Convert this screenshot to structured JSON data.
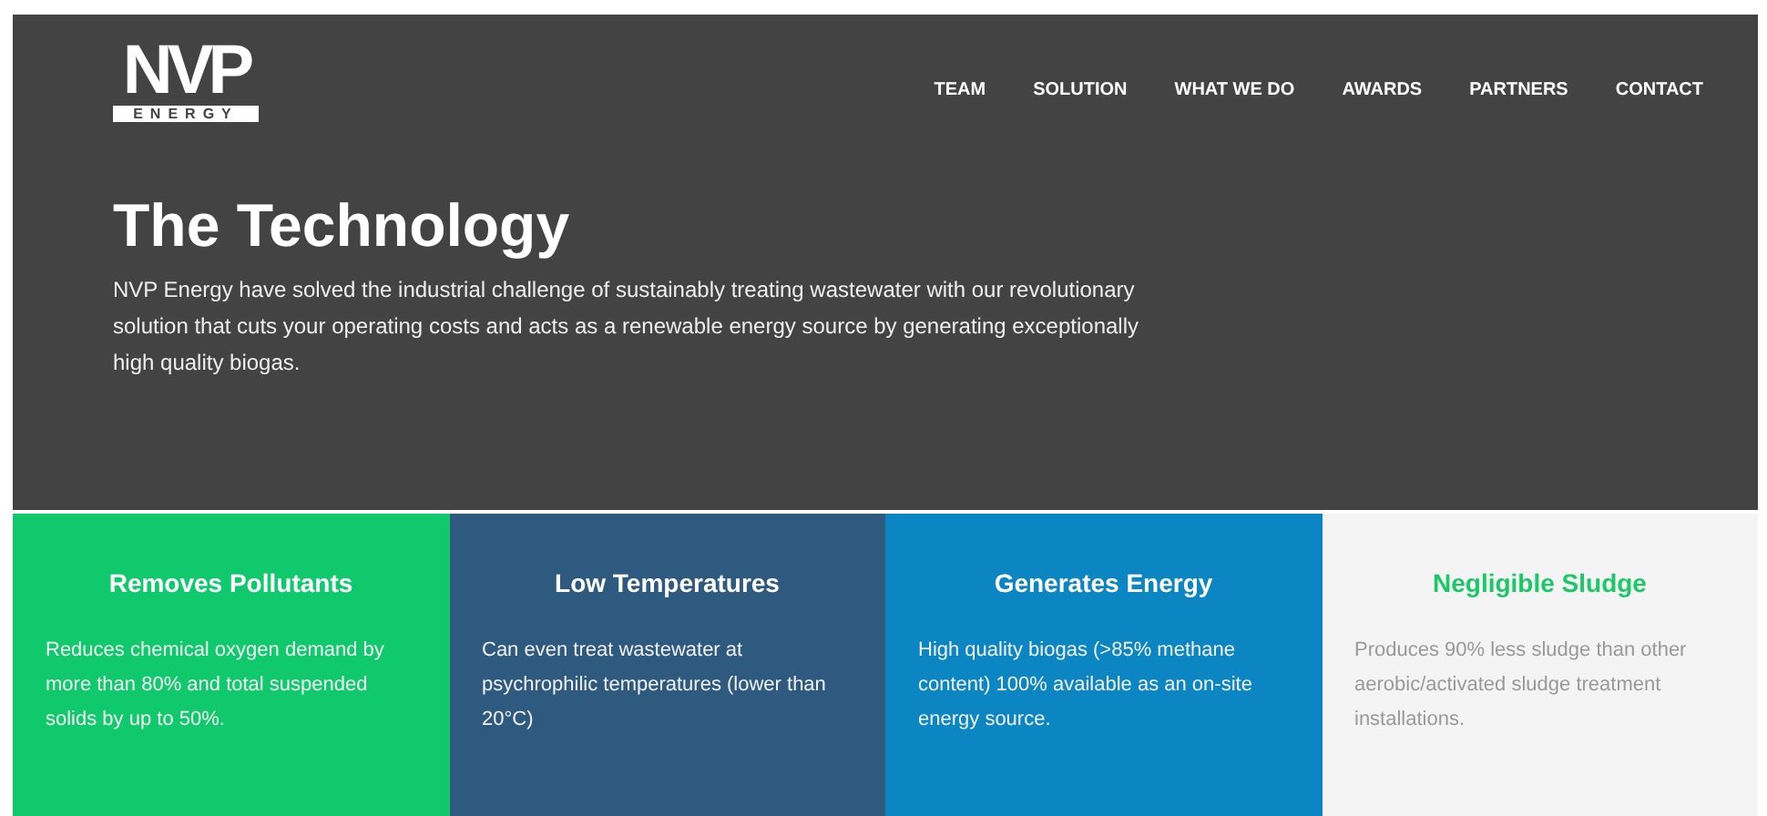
{
  "logo": {
    "mark": "NVP",
    "sub": "ENERGY"
  },
  "nav": [
    {
      "label": "TEAM"
    },
    {
      "label": "SOLUTION"
    },
    {
      "label": "WHAT WE DO"
    },
    {
      "label": "AWARDS"
    },
    {
      "label": "PARTNERS"
    },
    {
      "label": "CONTACT"
    }
  ],
  "hero": {
    "title": "The Technology",
    "text": "NVP Energy have solved the industrial challenge of sustainably treating wastewater with our revolutionary solution that cuts your operating costs and acts as a renewable energy source by generating exceptionally high quality biogas."
  },
  "features": [
    {
      "kind": "dark",
      "color": "#10c96d",
      "title": "Removes Pollutants",
      "text": "Reduces chemical oxygen demand by more than 80% and total suspended solids by up to 50%."
    },
    {
      "kind": "dark",
      "color": "#2e5a80",
      "title": "Low Temperatures",
      "text": "Can even treat wastewater at psychrophilic temperatures (lower than 20°C)"
    },
    {
      "kind": "dark",
      "color": "#0c85c3",
      "title": "Generates Energy",
      "text": "High quality biogas (>85% methane content) 100% available as an on-site energy source."
    },
    {
      "kind": "light",
      "color": "#f4f4f4",
      "title": "Negligible Sludge",
      "text": "Produces 90% less sludge than other aerobic/activated sludge treatment installations."
    }
  ]
}
